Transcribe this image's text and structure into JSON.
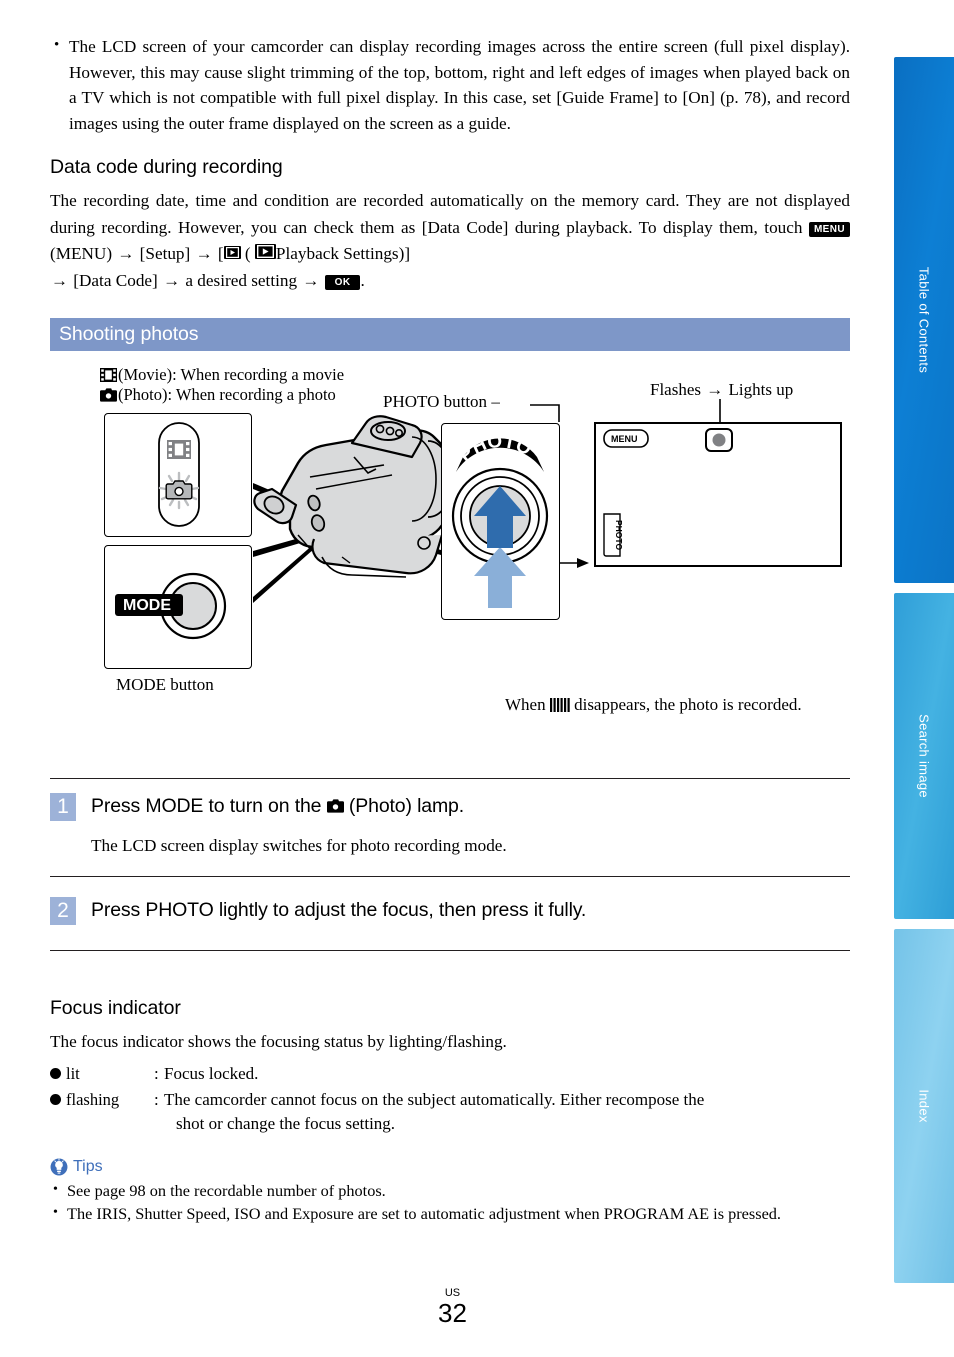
{
  "intro_bullets": [
    "The LCD screen of your camcorder can display recording images across the entire screen (full pixel display). However, this may cause slight trimming of the top, bottom, right and left edges of images when played back on a TV which is not compatible with full pixel display. In this case, set [Guide Frame] to [On] (p. 78), and record images using the outer frame displayed on the screen as a guide."
  ],
  "data_code": {
    "heading": "Data code during recording",
    "text_part1": "The recording date, time and condition are recorded automatically on the memory card. They are not displayed during recording. However, you can check them as [Data Code] during playback. To display them, touch ",
    "menu_key": "MENU",
    "text_part2": "(MENU)",
    "arrow": "→",
    "setup": "[Setup]",
    "bracket_open": "[",
    "playback_settings": "Playback Settings)]",
    "paren_open": "(",
    "data_code_item": "[Data Code]",
    "desired_setting": "a desired setting",
    "ok_key": "OK",
    "period": "."
  },
  "section": {
    "title": "Shooting photos"
  },
  "legend": {
    "movie": "(Movie): When recording a movie",
    "photo": "(Photo): When recording a photo"
  },
  "illustration": {
    "mode_label": "MODE",
    "mode_caption": "MODE button",
    "photo_label": "PHOTO",
    "photo_caption": "PHOTO button",
    "flashes": "Flashes",
    "flashes_arrow": "→",
    "lights_up": "Lights up",
    "lcd_menu": "MENU",
    "lcd_photo": "PHOTO",
    "when_prefix": "When",
    "when_suffix": "disappears, the photo is recorded."
  },
  "steps": [
    {
      "num": "1",
      "title_before": "Press MODE to turn on the",
      "title_after": "(Photo) lamp.",
      "desc": "The LCD screen display switches for photo recording mode."
    },
    {
      "num": "2",
      "title_before": "Press PHOTO lightly to adjust the focus, then press it fully.",
      "title_after": "",
      "desc": ""
    }
  ],
  "focus": {
    "heading": "Focus indicator",
    "intro": "The focus indicator shows the focusing status by lighting/flashing.",
    "rows": [
      {
        "key": "lit",
        "colon": ":",
        "value": "Focus locked.",
        "value2": ""
      },
      {
        "key": "flashing",
        "colon": ":",
        "value": "The camcorder cannot focus on the subject automatically. Either recompose the",
        "value2": "shot or change the focus setting."
      }
    ]
  },
  "tips": {
    "label": "Tips",
    "items": [
      "See page 98 on the recordable number of photos.",
      "The IRIS, Shutter Speed, ISO and Exposure are set to automatic adjustment when PROGRAM AE is pressed."
    ]
  },
  "sidebar": {
    "tabs": [
      {
        "label": "Table of Contents",
        "color": "#0d7fd4"
      },
      {
        "label": "Search image",
        "color": "#3aa9de"
      },
      {
        "label": "Index",
        "color": "#80c9ec"
      }
    ]
  },
  "footer": {
    "region": "US",
    "page": "32"
  },
  "colors": {
    "section_bar": "#7e97c8",
    "step_badge": "#9db2d8",
    "tips_blue": "#3f6fba",
    "arrow_dark": "#2f6cad",
    "arrow_light": "#8aafd8"
  }
}
